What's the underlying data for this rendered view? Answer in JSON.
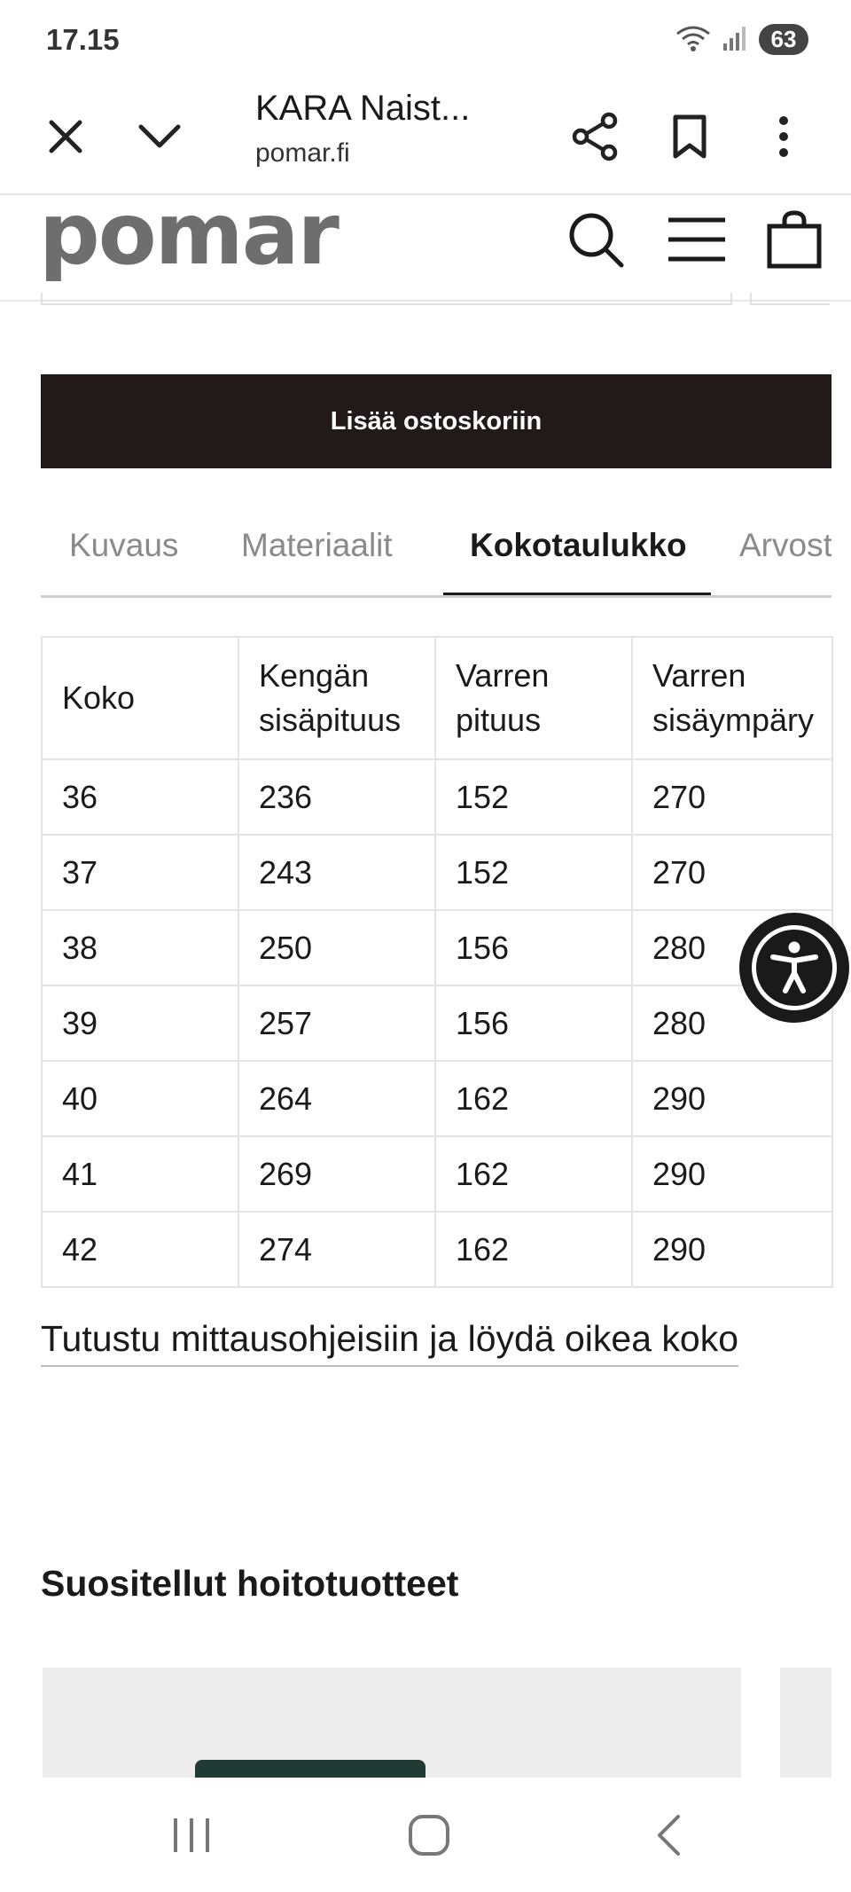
{
  "status": {
    "time": "17.15",
    "battery": "63"
  },
  "browser": {
    "title": "KARA Naist...",
    "url": "pomar.fi"
  },
  "site": {
    "logo": "pomar"
  },
  "actions": {
    "add_to_cart": "Lisää ostoskoriin"
  },
  "tabs": [
    {
      "label": "Kuvaus"
    },
    {
      "label": "Materiaalit"
    },
    {
      "label": "Kokotaulukko",
      "active": true
    },
    {
      "label": "Arvost"
    }
  ],
  "size_table": {
    "headers": [
      {
        "line1": "Koko",
        "line2": ""
      },
      {
        "line1": "Kengän",
        "line2": "sisäpituus"
      },
      {
        "line1": "Varren",
        "line2": "pituus"
      },
      {
        "line1": "Varren",
        "line2": "sisäympäry"
      }
    ],
    "rows": [
      [
        "36",
        "236",
        "152",
        "270"
      ],
      [
        "37",
        "243",
        "152",
        "270"
      ],
      [
        "38",
        "250",
        "156",
        "280"
      ],
      [
        "39",
        "257",
        "156",
        "280"
      ],
      [
        "40",
        "264",
        "162",
        "290"
      ],
      [
        "41",
        "269",
        "162",
        "290"
      ],
      [
        "42",
        "274",
        "162",
        "290"
      ]
    ]
  },
  "links": {
    "measure_guide": "Tutustu mittausohjeisiin ja löydä oikea koko"
  },
  "sections": {
    "care_products_title": "Suositellut hoitotuotteet"
  },
  "colors": {
    "cart_button": "#221a18",
    "logo": "#6e6e6e",
    "product_item": "#1f3b33"
  }
}
